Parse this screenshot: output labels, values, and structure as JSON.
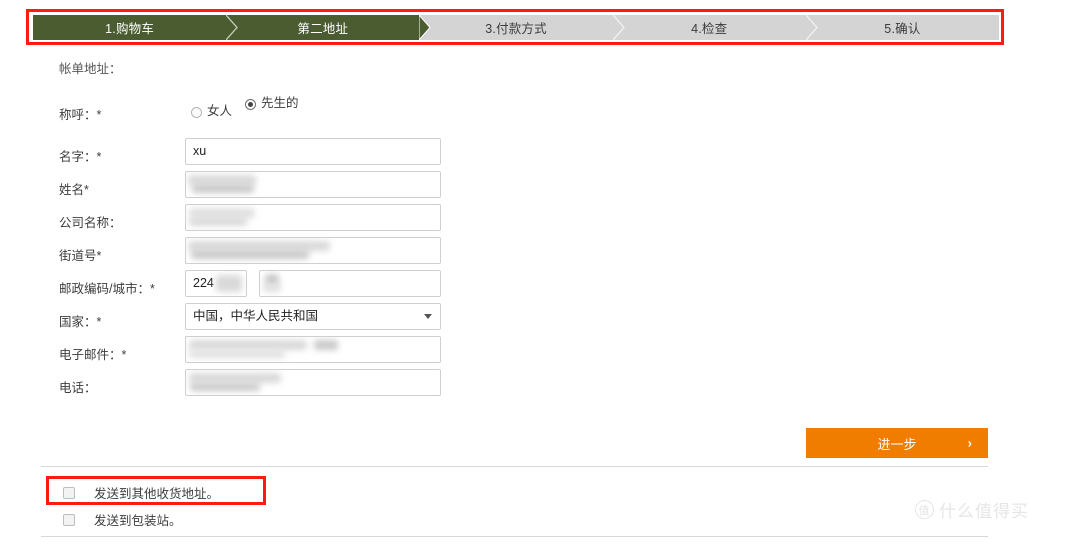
{
  "steps": [
    {
      "label": "1.购物车",
      "state": "done"
    },
    {
      "label": "第二地址",
      "state": "done"
    },
    {
      "label": "3.付款方式",
      "state": "todo"
    },
    {
      "label": "4.检查",
      "state": "todo"
    },
    {
      "label": "5.确认",
      "state": "todo"
    }
  ],
  "billing": {
    "title": "帐单地址：",
    "salutation_label": "称呼：*",
    "salutation_options": [
      {
        "label": "女人",
        "selected": false
      },
      {
        "label": "先生的",
        "selected": true
      }
    ],
    "fields": [
      {
        "label": "名字：*",
        "value": "xu",
        "redacted": false
      },
      {
        "label": "姓名*",
        "value": "",
        "redacted": true
      },
      {
        "label": "公司名称：",
        "value": "",
        "redacted": true
      },
      {
        "label": "街道号*",
        "value": "",
        "redacted": true
      }
    ],
    "postal_label": "邮政编码/城市：*",
    "postal_value": "224",
    "city_value": "",
    "country_label": "国家：*",
    "country_value": "中国，中华人民共和国",
    "email_label": "电子邮件：*",
    "email_value": "",
    "phone_label": "电话：",
    "phone_value": ""
  },
  "next_button": {
    "label": "进一步",
    "chevron": "›"
  },
  "checkboxes": [
    {
      "label": "发送到其他收货地址。",
      "checked": false
    },
    {
      "label": "发送到包装站。",
      "checked": false
    }
  ],
  "watermark": {
    "mark": "值",
    "text": "什么值得买"
  },
  "colors": {
    "step_done": "#4a5c30",
    "step_todo": "#d4d4d4",
    "accent_orange": "#f07d00",
    "annotation_red": "#ff1a12"
  }
}
